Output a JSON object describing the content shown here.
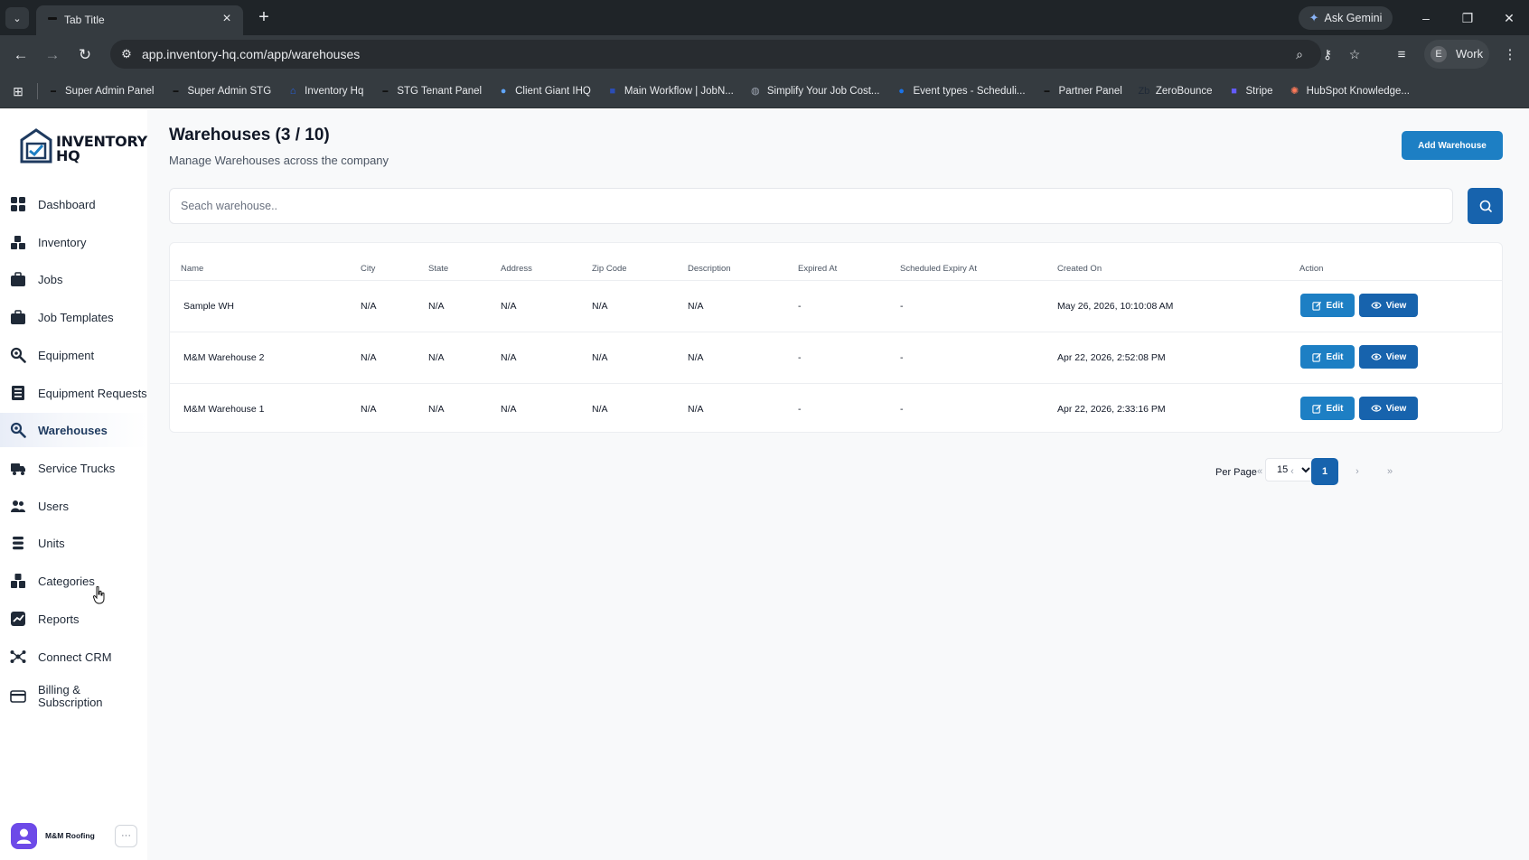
{
  "browser": {
    "tab_title": "Tab Title",
    "url": "app.inventory-hq.com/app/warehouses",
    "gemini_label": "Ask Gemini",
    "profile_initial": "E",
    "profile_label": "Work",
    "bookmarks": [
      {
        "label": "Super Admin Panel",
        "color": "#111111",
        "icon": "dash"
      },
      {
        "label": "Super Admin STG",
        "color": "#111111",
        "icon": "dash"
      },
      {
        "label": "Inventory Hq",
        "color": "#2563eb",
        "icon": "house"
      },
      {
        "label": "STG Tenant Panel",
        "color": "#111111",
        "icon": "dash"
      },
      {
        "label": "Client Giant IHQ",
        "color": "#60a5fa",
        "icon": "circle"
      },
      {
        "label": "Main Workflow | JobN...",
        "color": "#2b4db6",
        "icon": "square"
      },
      {
        "label": "Simplify Your Job Cost...",
        "color": "#9ca3af",
        "icon": "globe"
      },
      {
        "label": "Event types - Scheduli...",
        "color": "#1a73e8",
        "icon": "circle"
      },
      {
        "label": "Partner Panel",
        "color": "#111111",
        "icon": "dash"
      },
      {
        "label": "ZeroBounce",
        "color": "#1f2937",
        "icon": "zb"
      },
      {
        "label": "Stripe",
        "color": "#635bff",
        "icon": "square"
      },
      {
        "label": "HubSpot Knowledge...",
        "color": "#ff7a59",
        "icon": "hubspot"
      }
    ]
  },
  "brand": {
    "line1": "INVENTORY",
    "line2": "HQ"
  },
  "sidebar": {
    "items": [
      {
        "label": "Dashboard",
        "icon": "grid-icon"
      },
      {
        "label": "Inventory",
        "icon": "boxes-icon"
      },
      {
        "label": "Jobs",
        "icon": "briefcase-icon"
      },
      {
        "label": "Job Templates",
        "icon": "briefcase-icon"
      },
      {
        "label": "Equipment",
        "icon": "wrench-gear-icon"
      },
      {
        "label": "Equipment Requests",
        "icon": "clipboard-list-icon"
      },
      {
        "label": "Warehouses",
        "icon": "warehouse-gear-icon",
        "active": true
      },
      {
        "label": "Service Trucks",
        "icon": "truck-icon"
      },
      {
        "label": "Users",
        "icon": "users-icon"
      },
      {
        "label": "Units",
        "icon": "units-icon"
      },
      {
        "label": "Categories",
        "icon": "categories-icon"
      },
      {
        "label": "Reports",
        "icon": "chart-icon"
      },
      {
        "label": "Connect CRM",
        "icon": "network-icon"
      },
      {
        "label": "Billing & Subscription",
        "icon": "credit-card-icon"
      }
    ],
    "user": {
      "name": "M&M Roofing",
      "more": "···"
    }
  },
  "page": {
    "title": "Warehouses (3 / 10)",
    "subtitle": "Manage Warehouses across the company",
    "add_button": "Add Warehouse",
    "search_placeholder": "Seach warehouse.."
  },
  "table": {
    "columns": [
      "Name",
      "City",
      "State",
      "Address",
      "Zip Code",
      "Description",
      "Expired At",
      "Scheduled Expiry At",
      "Created On",
      "Action"
    ],
    "rows": [
      {
        "name": "Sample WH",
        "city": "N/A",
        "state": "N/A",
        "address": "N/A",
        "zip": "N/A",
        "description": "N/A",
        "expired_at": "-",
        "scheduled_expiry": "-",
        "created_on": "May 26, 2026, 10:10:08 AM"
      },
      {
        "name": "M&M Warehouse 2",
        "city": "N/A",
        "state": "N/A",
        "address": "N/A",
        "zip": "N/A",
        "description": "N/A",
        "expired_at": "-",
        "scheduled_expiry": "-",
        "created_on": "Apr 22, 2026, 2:52:08 PM"
      },
      {
        "name": "M&M Warehouse 1",
        "city": "N/A",
        "state": "N/A",
        "address": "N/A",
        "zip": "N/A",
        "description": "N/A",
        "expired_at": "-",
        "scheduled_expiry": "-",
        "created_on": "Apr 22, 2026, 2:33:16 PM"
      }
    ],
    "edit_label": "Edit",
    "view_label": "View"
  },
  "pagination": {
    "per_page_label": "Per Page",
    "per_page_value": "15",
    "first": "«",
    "prev": "‹",
    "current": "1",
    "next": "›",
    "last": "»"
  },
  "colors": {
    "accent": "#1763ad",
    "button": "#1d7fc4",
    "active_nav": "#1e3a5f"
  }
}
